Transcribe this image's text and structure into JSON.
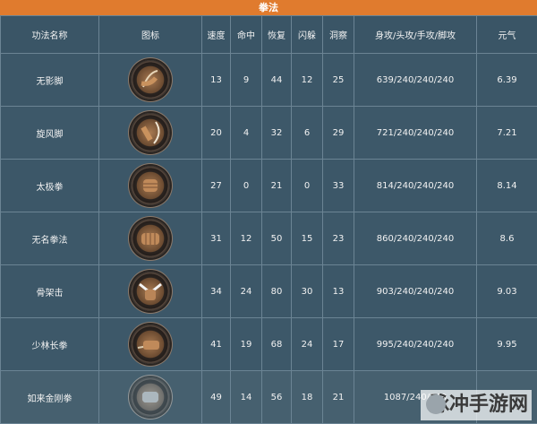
{
  "title": "拳法",
  "headers": [
    "功法名称",
    "图标",
    "速度",
    "命中",
    "恢复",
    "闪躲",
    "洞察",
    "身攻/头攻/手攻/脚攻",
    "元气"
  ],
  "rows": [
    {
      "name": "无影脚",
      "icon": "kick-icon",
      "speed": "13",
      "hit": "9",
      "recover": "44",
      "dodge": "12",
      "insight": "25",
      "attack": "639/240/240/240",
      "qi": "6.39"
    },
    {
      "name": "旋风脚",
      "icon": "whirlwind-kick-icon",
      "speed": "20",
      "hit": "4",
      "recover": "32",
      "dodge": "6",
      "insight": "29",
      "attack": "721/240/240/240",
      "qi": "7.21"
    },
    {
      "name": "太极拳",
      "icon": "fist-icon",
      "speed": "27",
      "hit": "0",
      "recover": "21",
      "dodge": "0",
      "insight": "33",
      "attack": "814/240/240/240",
      "qi": "8.14"
    },
    {
      "name": "无名拳法",
      "icon": "fist-icon",
      "speed": "31",
      "hit": "12",
      "recover": "50",
      "dodge": "15",
      "insight": "23",
      "attack": "860/240/240/240",
      "qi": "8.6"
    },
    {
      "name": "骨架击",
      "icon": "bone-strike-icon",
      "speed": "34",
      "hit": "24",
      "recover": "80",
      "dodge": "30",
      "insight": "13",
      "attack": "903/240/240/240",
      "qi": "9.03"
    },
    {
      "name": "少林长拳",
      "icon": "long-fist-icon",
      "speed": "41",
      "hit": "19",
      "recover": "68",
      "dodge": "24",
      "insight": "17",
      "attack": "995/240/240/240",
      "qi": "9.95"
    },
    {
      "name": "如来金刚拳",
      "icon": "palm-icon",
      "speed": "49",
      "hit": "14",
      "recover": "56",
      "dodge": "18",
      "insight": "21",
      "attack": "1087/240/240",
      "qi": ""
    }
  ],
  "watermark": "脉冲手游网"
}
